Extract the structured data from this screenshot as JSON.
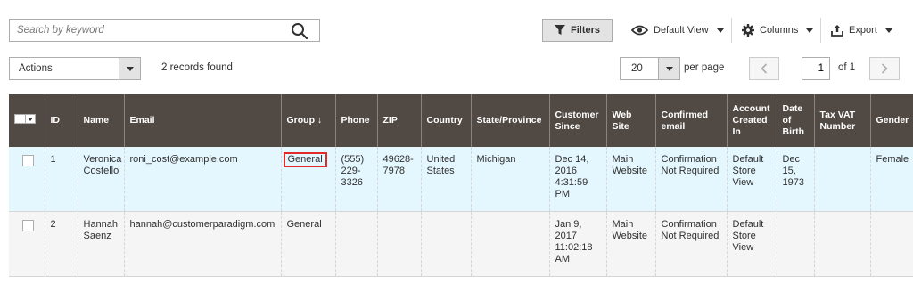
{
  "search": {
    "placeholder": "Search by keyword"
  },
  "toolbar": {
    "filters_label": "Filters",
    "view_label": "Default View",
    "columns_label": "Columns",
    "export_label": "Export"
  },
  "actions": {
    "label": "Actions"
  },
  "records_found": "2 records found",
  "pager": {
    "per_page_value": "20",
    "per_page_label": "per page",
    "current_page": "1",
    "of_label": "of 1"
  },
  "columns": {
    "id": "ID",
    "name": "Name",
    "email": "Email",
    "group": "Group",
    "group_sort": "↓",
    "phone": "Phone",
    "zip": "ZIP",
    "country": "Country",
    "state": "State/Province",
    "customer_since": "Customer Since",
    "web_site": "Web Site",
    "confirmed_email": "Confirmed email",
    "account_created_in": "Account Created In",
    "date_of_birth": "Date of Birth",
    "tax_vat": "Tax VAT Number",
    "gender": "Gender"
  },
  "rows": [
    {
      "id": "1",
      "name": "Veronica Costello",
      "email": "roni_cost@example.com",
      "group": "General",
      "phone": "(555) 229-3326",
      "zip": "49628-7978",
      "country": "United States",
      "state": "Michigan",
      "customer_since": "Dec 14, 2016 4:31:59 PM",
      "web_site": "Main Website",
      "confirmed_email": "Confirmation Not Required",
      "account_created_in": "Default Store View",
      "date_of_birth": "Dec 15, 1973",
      "tax_vat": "",
      "gender": "Female"
    },
    {
      "id": "2",
      "name": "Hannah Saenz",
      "email": "hannah@customerparadigm.com",
      "group": "General",
      "phone": "",
      "zip": "",
      "country": "",
      "state": "",
      "customer_since": "Jan 9, 2017 11:02:18 AM",
      "web_site": "Main Website",
      "confirmed_email": "Confirmation Not Required",
      "account_created_in": "Default Store View",
      "date_of_birth": "",
      "tax_vat": "",
      "gender": ""
    }
  ]
}
